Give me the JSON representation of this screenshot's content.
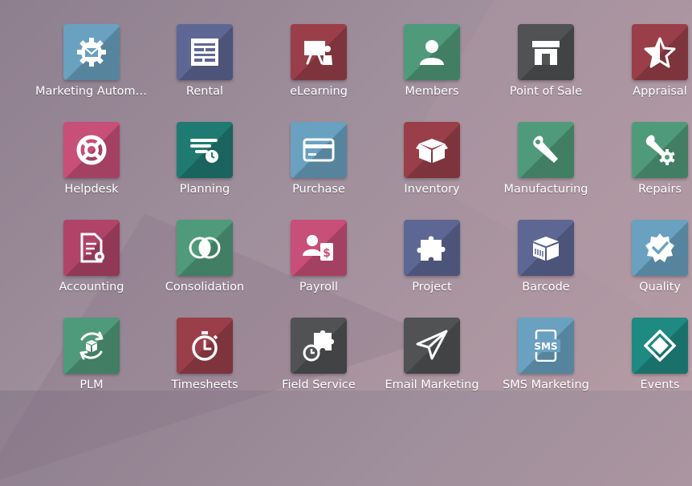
{
  "apps": [
    {
      "label": "Marketing Automation",
      "icon": "gear-envelope-icon",
      "color": "#6aa1c0"
    },
    {
      "label": "Rental",
      "icon": "calendar-board-icon",
      "color": "#5e6794"
    },
    {
      "label": "eLearning",
      "icon": "presentation-icon",
      "color": "#9a3f49"
    },
    {
      "label": "Members",
      "icon": "person-icon",
      "color": "#4f9a7a"
    },
    {
      "label": "Point of Sale",
      "icon": "shop-icon",
      "color": "#505253"
    },
    {
      "label": "Appraisal",
      "icon": "star-icon",
      "color": "#9a3f49"
    },
    {
      "label": "Helpdesk",
      "icon": "lifebuoy-icon",
      "color": "#c84f77"
    },
    {
      "label": "Planning",
      "icon": "planning-clock-icon",
      "color": "#1f7a71"
    },
    {
      "label": "Purchase",
      "icon": "credit-card-icon",
      "color": "#6aa1c0"
    },
    {
      "label": "Inventory",
      "icon": "box-icon",
      "color": "#9a3f49"
    },
    {
      "label": "Manufacturing",
      "icon": "wrench-icon",
      "color": "#4f9a7a"
    },
    {
      "label": "Repairs",
      "icon": "wrench-gear-icon",
      "color": "#4f9a7a"
    },
    {
      "label": "Accounting",
      "icon": "document-gear-icon",
      "color": "#b04468"
    },
    {
      "label": "Consolidation",
      "icon": "overlap-circles-icon",
      "color": "#4f9a7a"
    },
    {
      "label": "Payroll",
      "icon": "person-dollar-icon",
      "color": "#c84f77"
    },
    {
      "label": "Project",
      "icon": "puzzle-icon",
      "color": "#5e6794"
    },
    {
      "label": "Barcode",
      "icon": "barcode-box-icon",
      "color": "#5e6794"
    },
    {
      "label": "Quality",
      "icon": "badge-check-icon",
      "color": "#6aa1c0"
    },
    {
      "label": "PLM",
      "icon": "cycle-box-icon",
      "color": "#4f9a7a"
    },
    {
      "label": "Timesheets",
      "icon": "stopwatch-icon",
      "color": "#9a3f49"
    },
    {
      "label": "Field Service",
      "icon": "puzzle-clock-icon",
      "color": "#505253"
    },
    {
      "label": "Email Marketing",
      "icon": "paper-plane-icon",
      "color": "#505253"
    },
    {
      "label": "SMS Marketing",
      "icon": "phone-sms-icon",
      "color": "#6aa1c0"
    },
    {
      "label": "Events",
      "icon": "ticket-icon",
      "color": "#1f8a82"
    }
  ],
  "sms_text": "SMS"
}
